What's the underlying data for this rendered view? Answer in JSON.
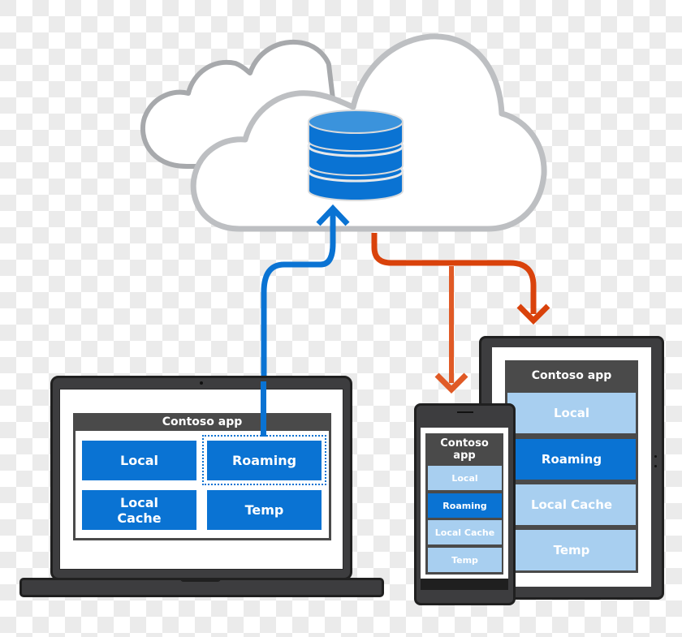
{
  "colors": {
    "upload_arrow": "#0a73d3",
    "download_arrow": "#d9420b",
    "tile_blue": "#0a73d3",
    "tile_light": "#a8cff0",
    "device_body": "#3d3d3f",
    "app_header": "#4a4a4a",
    "cloud_stroke": "#bdbfc2"
  },
  "cloud": {
    "icon": "database-icon"
  },
  "laptop": {
    "app_title": "Contoso app",
    "tiles": [
      {
        "label": "Local",
        "highlighted": false
      },
      {
        "label": "Roaming",
        "highlighted": true
      },
      {
        "label": "Local Cache",
        "line1": "Local",
        "line2": "Cache",
        "highlighted": false
      },
      {
        "label": "Temp",
        "highlighted": false
      }
    ]
  },
  "phone": {
    "app_title_line1": "Contoso",
    "app_title_line2": "app",
    "rows": [
      {
        "label": "Local",
        "active": false
      },
      {
        "label": "Roaming",
        "active": true
      },
      {
        "label": "Local Cache",
        "active": false
      },
      {
        "label": "Temp",
        "active": false
      }
    ]
  },
  "tablet": {
    "app_title": "Contoso app",
    "rows": [
      {
        "label": "Local",
        "active": false
      },
      {
        "label": "Roaming",
        "active": true
      },
      {
        "label": "Local Cache",
        "active": false
      },
      {
        "label": "Temp",
        "active": false
      }
    ]
  }
}
